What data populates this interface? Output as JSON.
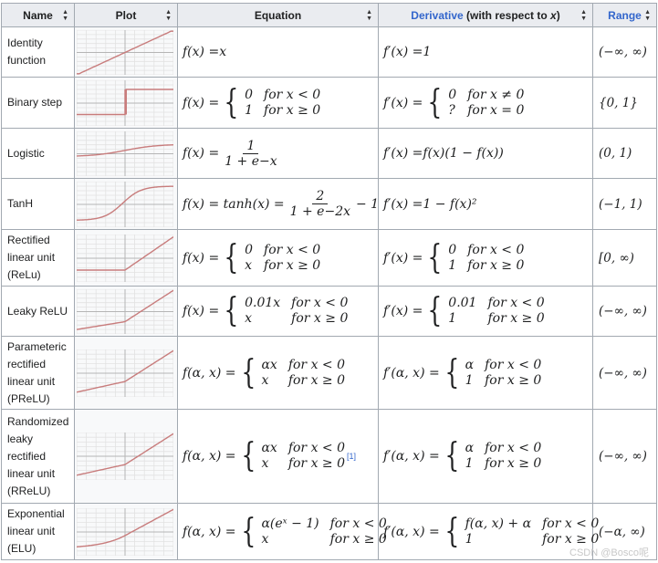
{
  "headers": [
    {
      "name": "col-name",
      "text": "Name"
    },
    {
      "name": "col-plot",
      "text": "Plot"
    },
    {
      "name": "col-equation",
      "text": "Equation"
    },
    {
      "name": "col-derivative",
      "link": "Derivative",
      "rest": " (with respect to ",
      "var": "x",
      "close": ")"
    },
    {
      "name": "col-range",
      "link": "Range"
    }
  ],
  "sort_icon": "sort-arrows-icon",
  "rows": [
    {
      "key": "identity",
      "name": "Identity function",
      "eq": {
        "lhs": "f(x) = ",
        "rhs": "x"
      },
      "der": {
        "lhs": "f′(x) = ",
        "rhs": "1"
      },
      "range": "(−∞, ∞)"
    },
    {
      "key": "binary-step",
      "name": "Binary step",
      "eq": {
        "lhs": "f(x) = ",
        "cases": [
          [
            "0",
            "for x < 0"
          ],
          [
            "1",
            "for x ≥ 0"
          ]
        ]
      },
      "der": {
        "lhs": "f′(x) = ",
        "cases": [
          [
            "0",
            "for x ≠ 0"
          ],
          [
            "?",
            "for x = 0"
          ]
        ]
      },
      "range": "{0, 1}"
    },
    {
      "key": "logistic",
      "name": "Logistic",
      "eq": {
        "lhs": "f(x) = ",
        "frac_num": "1",
        "frac_den": "1 + e−x"
      },
      "der": {
        "lhs": "f′(x) = ",
        "rhs": "f(x)(1 − f(x))"
      },
      "range": "(0, 1)"
    },
    {
      "key": "tanh",
      "name": "TanH",
      "eq": {
        "lhs": "f(x) = tanh(x) = ",
        "frac_num": "2",
        "frac_den": "1 + e−2x",
        "tail": " − 1"
      },
      "der": {
        "lhs": "f′(x) = ",
        "rhs": "1 − f(x)²"
      },
      "range": "(−1, 1)"
    },
    {
      "key": "relu",
      "name": "Rectified linear unit (ReLu)",
      "eq": {
        "lhs": "f(x) = ",
        "cases": [
          [
            "0",
            "for x < 0"
          ],
          [
            "x",
            "for x ≥ 0"
          ]
        ]
      },
      "der": {
        "lhs": "f′(x) = ",
        "cases": [
          [
            "0",
            "for x < 0"
          ],
          [
            "1",
            "for x ≥ 0"
          ]
        ]
      },
      "range": "[0, ∞)"
    },
    {
      "key": "leaky-relu",
      "name": "Leaky ReLU",
      "eq": {
        "lhs": "f(x) = ",
        "cases": [
          [
            "0.01x",
            "for x < 0"
          ],
          [
            "x",
            "for x ≥ 0"
          ]
        ]
      },
      "der": {
        "lhs": "f′(x) = ",
        "cases": [
          [
            "0.01",
            "for x < 0"
          ],
          [
            "1",
            "for x ≥ 0"
          ]
        ]
      },
      "range": "(−∞, ∞)"
    },
    {
      "key": "prelu",
      "name": "Parameteric rectified linear unit (PReLU)",
      "eq": {
        "lhs": "f(α, x) = ",
        "cases": [
          [
            "αx",
            "for x < 0"
          ],
          [
            "x",
            "for x ≥ 0"
          ]
        ]
      },
      "der": {
        "lhs": "f′(α, x) = ",
        "cases": [
          [
            "α",
            "for x < 0"
          ],
          [
            "1",
            "for x ≥ 0"
          ]
        ]
      },
      "range": "(−∞, ∞)"
    },
    {
      "key": "rrelu",
      "name": "Randomized leaky rectified linear unit (RReLU)",
      "eq": {
        "lhs": "f(α, x) = ",
        "cases": [
          [
            "αx",
            "for x < 0"
          ],
          [
            "x",
            "for x ≥ 0"
          ]
        ],
        "ref": "[1]"
      },
      "der": {
        "lhs": "f′(α, x) = ",
        "cases": [
          [
            "α",
            "for x < 0"
          ],
          [
            "1",
            "for x ≥ 0"
          ]
        ]
      },
      "range": "(−∞, ∞)"
    },
    {
      "key": "elu",
      "name": "Exponential linear unit (ELU)",
      "eq": {
        "lhs": "f(α, x) = ",
        "cases": [
          [
            "α(eˣ − 1)",
            "for x < 0"
          ],
          [
            "x",
            "for x ≥ 0"
          ]
        ]
      },
      "der": {
        "lhs": "f′(α, x) = ",
        "cases": [
          [
            "f(α, x) + α",
            "for x < 0"
          ],
          [
            "1",
            "for x ≥ 0"
          ]
        ]
      },
      "range": "(−α, ∞)"
    }
  ],
  "watermark": "CSDN @Bosco呢",
  "colors": {
    "curve": "#c87c7c",
    "grid": "#e2e2e2",
    "axis": "#b5b5b5",
    "header_bg": "#eaecf0",
    "link": "#3366cc"
  }
}
